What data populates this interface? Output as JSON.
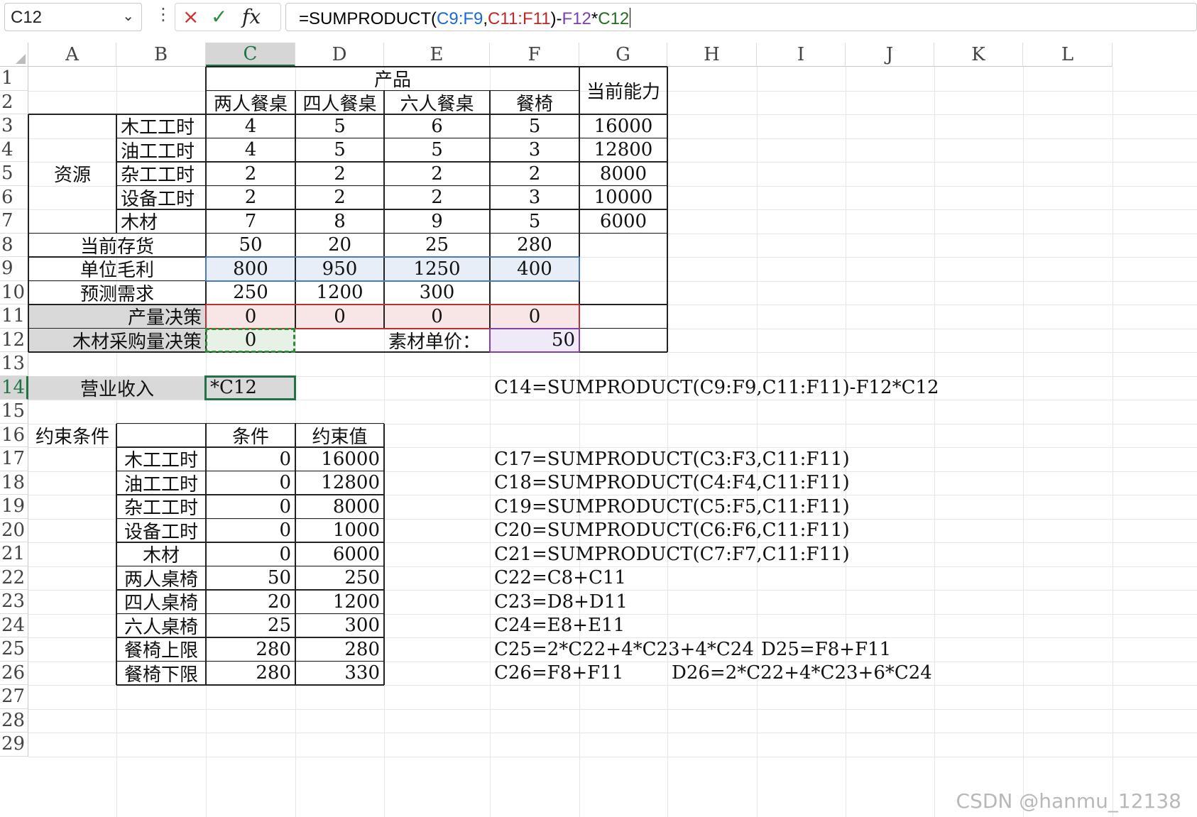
{
  "formula_bar": {
    "name_box": "C12",
    "cancel_icon": "×",
    "enter_icon": "✓",
    "fx_label": "fx",
    "formula_parts": [
      "=SUMPRODUCT(",
      "C9:F9",
      ",",
      "C11:F11",
      ")-",
      "F12",
      "*",
      "C12"
    ]
  },
  "columns": [
    "A",
    "B",
    "C",
    "D",
    "E",
    "F",
    "G",
    "H",
    "I",
    "J",
    "K",
    "L"
  ],
  "rows": [
    "1",
    "2",
    "3",
    "4",
    "5",
    "6",
    "7",
    "8",
    "9",
    "10",
    "11",
    "12",
    "13",
    "14",
    "15",
    "16",
    "17",
    "18",
    "19",
    "20",
    "21",
    "22",
    "23",
    "24",
    "25",
    "26",
    "27",
    "28",
    "29"
  ],
  "selected": {
    "column": "C",
    "row": "14"
  },
  "cells": {
    "product_header": "产品",
    "capacity_header": "当前能力",
    "products": [
      "两人餐桌",
      "四人餐桌",
      "六人餐桌",
      "餐椅"
    ],
    "resource_label": "资源",
    "resources": [
      {
        "name": "木工工时",
        "values": [
          "4",
          "5",
          "6",
          "5"
        ],
        "capacity": "16000"
      },
      {
        "name": "油工工时",
        "values": [
          "4",
          "5",
          "5",
          "3"
        ],
        "capacity": "12800"
      },
      {
        "name": "杂工工时",
        "values": [
          "2",
          "2",
          "2",
          "2"
        ],
        "capacity": "8000"
      },
      {
        "name": "设备工时",
        "values": [
          "2",
          "2",
          "2",
          "3"
        ],
        "capacity": "10000"
      },
      {
        "name": "木材",
        "values": [
          "7",
          "8",
          "9",
          "5"
        ],
        "capacity": "6000"
      }
    ],
    "inventory_label": "当前存货",
    "inventory": [
      "50",
      "20",
      "25",
      "280"
    ],
    "margin_label": "单位毛利",
    "margin": [
      "800",
      "950",
      "1250",
      "400"
    ],
    "demand_label": "预测需求",
    "demand": [
      "250",
      "1200",
      "300",
      ""
    ],
    "decision_label": "产量决策",
    "decision": [
      "0",
      "0",
      "0",
      "0"
    ],
    "wood_purchase_label": "木材采购量决策",
    "wood_purchase": "0",
    "material_price_label": "素材单价：",
    "material_price": "50",
    "revenue_label": "营业收入",
    "revenue_value": "*C12",
    "revenue_note": "C14=SUMPRODUCT(C9:F9,C11:F11)-F12*C12",
    "constraints_label": "约束条件",
    "constraint_headers": [
      "条件",
      "约束值"
    ],
    "constraints": [
      {
        "name": "木工工时",
        "cond": "0",
        "limit": "16000",
        "note": "C17=SUMPRODUCT(C3:F3,C11:F11)",
        "note2": ""
      },
      {
        "name": "油工工时",
        "cond": "0",
        "limit": "12800",
        "note": "C18=SUMPRODUCT(C4:F4,C11:F11)",
        "note2": ""
      },
      {
        "name": "杂工工时",
        "cond": "0",
        "limit": "8000",
        "note": "C19=SUMPRODUCT(C5:F5,C11:F11)",
        "note2": ""
      },
      {
        "name": "设备工时",
        "cond": "0",
        "limit": "1000",
        "note": "C20=SUMPRODUCT(C6:F6,C11:F11)",
        "note2": ""
      },
      {
        "name": "木材",
        "cond": "0",
        "limit": "6000",
        "note": "C21=SUMPRODUCT(C7:F7,C11:F11)",
        "note2": ""
      },
      {
        "name": "两人桌椅",
        "cond": "50",
        "limit": "250",
        "note": "C22=C8+C11",
        "note2": ""
      },
      {
        "name": "四人桌椅",
        "cond": "20",
        "limit": "1200",
        "note": "C23=D8+D11",
        "note2": ""
      },
      {
        "name": "六人桌椅",
        "cond": "25",
        "limit": "300",
        "note": "C24=E8+E11",
        "note2": ""
      },
      {
        "name": "餐椅上限",
        "cond": "280",
        "limit": "280",
        "note": "C25=2*C22+4*C23+4*C24",
        "note2": "D25=F8+F11"
      },
      {
        "name": "餐椅下限",
        "cond": "280",
        "limit": "330",
        "note": "C26=F8+F11",
        "note2": "D26=2*C22+4*C23+6*C24"
      }
    ]
  },
  "watermark": "CSDN @hanmu_12138"
}
